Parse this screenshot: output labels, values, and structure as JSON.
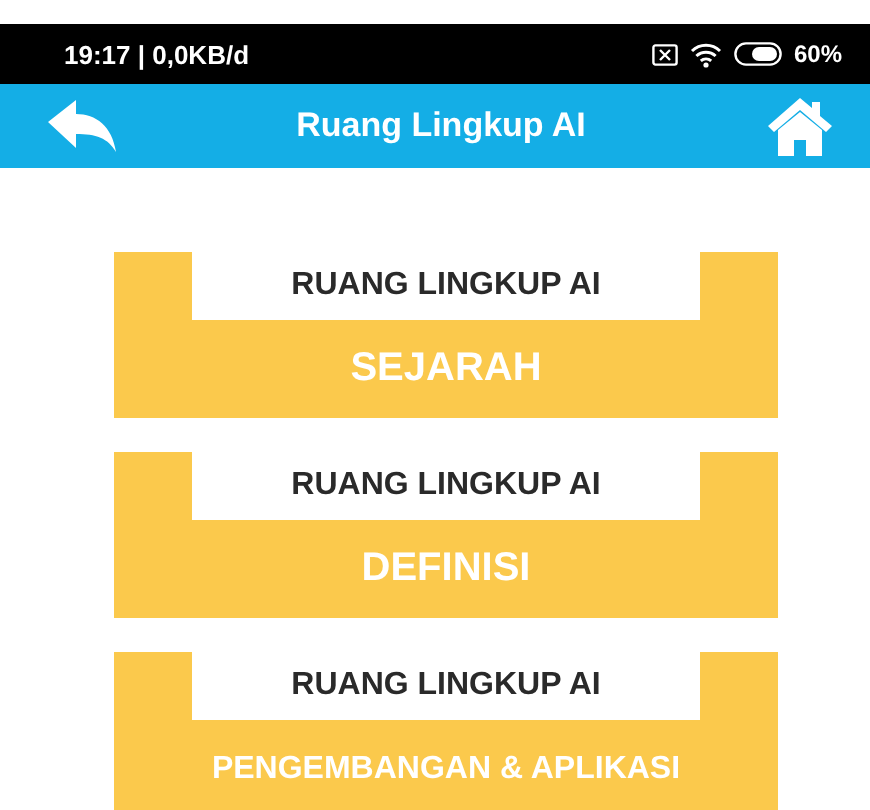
{
  "status_bar": {
    "time": "19:17 | 0,0KB/d",
    "battery": "60%"
  },
  "app_bar": {
    "title": "Ruang Lingkup AI"
  },
  "menu": [
    {
      "heading": "RUANG LINGKUP AI",
      "label": "SEJARAH"
    },
    {
      "heading": "RUANG LINGKUP AI",
      "label": "DEFINISI"
    },
    {
      "heading": "RUANG LINGKUP AI",
      "label": "PENGEMBANGAN & APLIKASI"
    }
  ]
}
